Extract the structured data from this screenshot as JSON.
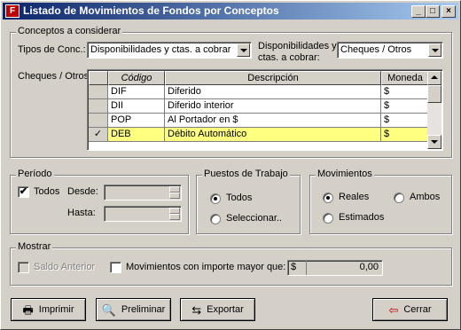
{
  "window": {
    "title": "Listado de Movimientos de Fondos por Conceptos",
    "title_icon": "F",
    "controls": {
      "minimize": "_",
      "maximize": "□",
      "close": "×"
    }
  },
  "conceptos": {
    "legend": "Conceptos a considerar",
    "tipos_label": "Tipos de Conc.:",
    "tipos_value": "Disponibilidades y ctas. a cobrar",
    "disp_label_1": "Disponibilidades y",
    "disp_label_2": "ctas. a cobrar:",
    "disp_value": "Cheques / Otros",
    "grid_label": "Cheques / Otros",
    "columns": [
      "Código",
      "Descripción",
      "Moneda"
    ],
    "rows": [
      {
        "check": "",
        "codigo": "DIF",
        "descripcion": "Diferido",
        "moneda": "$"
      },
      {
        "check": "",
        "codigo": "DII",
        "descripcion": "Diferido interior",
        "moneda": "$"
      },
      {
        "check": "",
        "codigo": "POP",
        "descripcion": "Al Portador en $",
        "moneda": "$"
      },
      {
        "check": "✓",
        "codigo": "DEB",
        "descripcion": "Débito Automático",
        "moneda": "$"
      }
    ]
  },
  "periodo": {
    "legend": "Período",
    "todos_label": "Todos",
    "todos_checked": "✔",
    "desde_label": "Desde:",
    "hasta_label": "Hasta:"
  },
  "puestos": {
    "legend": "Puestos de Trabajo",
    "todos_label": "Todos",
    "seleccionar_label": "Seleccionar.."
  },
  "movimientos": {
    "legend": "Movimientos",
    "reales_label": "Reales",
    "ambos_label": "Ambos",
    "estimados_label": "Estimados"
  },
  "mostrar": {
    "legend": "Mostrar",
    "saldo_label": "Saldo Anterior",
    "mov_label": "Movimientos con importe mayor que:",
    "currency": "$",
    "amount": "0,00"
  },
  "buttons": {
    "imprimir": "Imprimir",
    "preliminar": "Preliminar",
    "exportar": "Exportar",
    "cerrar": "Cerrar"
  },
  "icons": {
    "printer": "🖶",
    "preview": "🔍",
    "export": "⇆",
    "exit": "⇦"
  }
}
